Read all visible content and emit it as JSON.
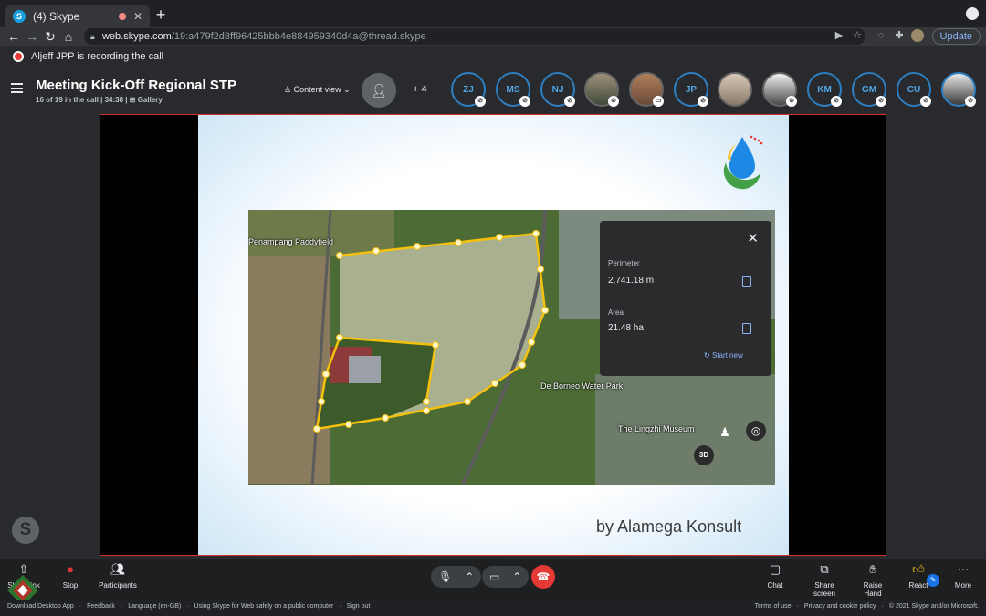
{
  "browser": {
    "tab_title": "(4) Skype",
    "url_domain": "web.skype.com",
    "url_path": "/19:a479f2d8ff96425bbb4e884959340d4a@thread.skype",
    "update_label": "Update"
  },
  "recording_notice": "Aljeff JPP is recording the call",
  "meeting": {
    "title": "Meeting Kick-Off Regional STP",
    "participants_info": "16 of 19 in the call",
    "duration": "34:38",
    "view_mode": "Gallery",
    "content_view_label": "Content view",
    "extra_count": "+ 4"
  },
  "participants": [
    {
      "initials": "ZJ"
    },
    {
      "initials": "MS"
    },
    {
      "initials": "NJ"
    },
    {
      "initials": ""
    },
    {
      "initials": ""
    },
    {
      "initials": "JP"
    },
    {
      "initials": ""
    },
    {
      "initials": ""
    },
    {
      "initials": "KM"
    },
    {
      "initials": "GM"
    },
    {
      "initials": "CU"
    },
    {
      "initials": ""
    }
  ],
  "slide": {
    "byline": "by Alamega Konsult",
    "map": {
      "perimeter_label": "Perimeter",
      "perimeter_value": "2,741.18 m",
      "area_label": "Area",
      "area_value": "21.48 ha",
      "start_new_label": "Start new",
      "labels": [
        "Penampang Paddyfield",
        "De Borneo Water Park",
        "The Lingzhi Museum"
      ],
      "btn_3d": "3D"
    }
  },
  "toolbar": {
    "share_link": "Share link",
    "stop": "Stop",
    "participants": "Participants",
    "chat": "Chat",
    "share_screen": "Share screen",
    "raise_hand": "Raise Hand",
    "react": "React",
    "more": "More"
  },
  "footer": {
    "left": [
      "Download Desktop App",
      "Feedback",
      "Language (en-GB)",
      "Using Skype for Web safely on a public computer",
      "Sign out"
    ],
    "right": [
      "Terms of use",
      "Privacy and cookie policy",
      "© 2021 Skype and/or Microsoft."
    ]
  },
  "colors": {
    "accent": "#2d7fc1",
    "record": "#e53935",
    "stage_border": "#d93025"
  }
}
